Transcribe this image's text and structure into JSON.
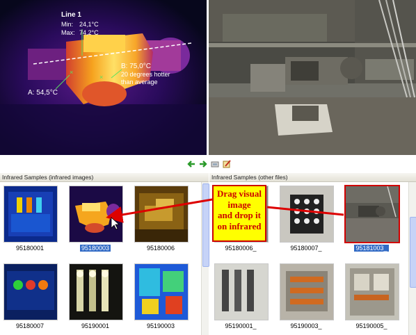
{
  "ir_preview": {
    "line_title": "Line 1",
    "min_label": "Min:",
    "min_value": "24,1°C",
    "max_label": "Max:",
    "max_value": "74,2°C",
    "point_a": "A: 54,5°C",
    "point_b": "B: 75,0°C",
    "point_b_note1": "20 degrees hotter",
    "point_b_note2": "than average"
  },
  "toolbar": {
    "icons": [
      "back-arrow-icon",
      "forward-arrow-icon",
      "display-icon",
      "edit-icon"
    ]
  },
  "left_pane": {
    "title": "Infrared Samples (infrared images)",
    "items": [
      {
        "label": "95180001"
      },
      {
        "label": "95180003",
        "selected": true
      },
      {
        "label": "95180006"
      },
      {
        "label": "95180007"
      },
      {
        "label": "95190001"
      },
      {
        "label": "95190003"
      }
    ]
  },
  "right_pane": {
    "title": "Infrared Samples (other files)",
    "items": [
      {
        "label": "95180006_"
      },
      {
        "label": "95180007_"
      },
      {
        "label": "95181003_",
        "selected": true
      },
      {
        "label": "95190001_"
      },
      {
        "label": "95190003_"
      },
      {
        "label": "95190005_"
      }
    ]
  },
  "callout": {
    "line1": "Drag visual",
    "line2": "image",
    "line3": "and drop it",
    "line4": "on infrared"
  },
  "colors": {
    "selection": "#316ac5",
    "callout_fill": "#ffff00",
    "callout_border": "#cc0000",
    "arrow": "#dd0000"
  }
}
